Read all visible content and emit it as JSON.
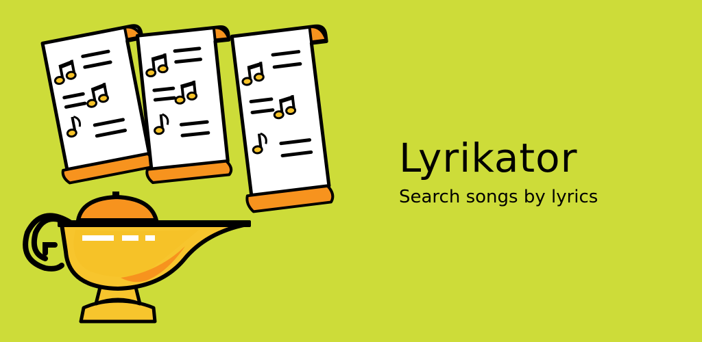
{
  "app": {
    "title": "Lyrikator",
    "tagline": "Search songs by lyrics"
  },
  "colors": {
    "background": "#cddc39",
    "paper": "#ffffff",
    "outline": "#000000",
    "orange": "#f7931e",
    "lamp_yellow": "#f7c52d",
    "note_yellow": "#f6c228"
  },
  "icons": [
    "lyrics-sheet-icon",
    "magic-lamp-icon",
    "music-note-icon"
  ]
}
